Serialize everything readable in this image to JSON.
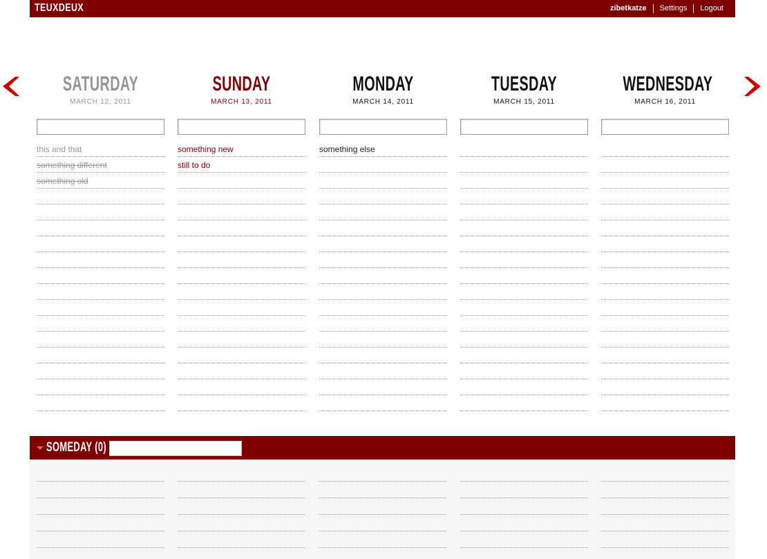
{
  "app": {
    "logo": "TEUXDEUX",
    "username": "zibetkatze",
    "settings_label": "Settings",
    "logout_label": "Logout",
    "brand_color": "#7f0000"
  },
  "nav": {
    "prev_icon": "chevron-left-icon",
    "next_icon": "chevron-right-icon",
    "arrow_color": "#cc0000"
  },
  "days": [
    {
      "name": "SATURDAY",
      "date": "MARCH 12, 2011",
      "state": "past",
      "input_value": "",
      "todos": [
        {
          "text": "this and that",
          "done": false
        },
        {
          "text": "something different",
          "done": true
        },
        {
          "text": "something old",
          "done": true
        }
      ]
    },
    {
      "name": "SUNDAY",
      "date": "MARCH 13, 2011",
      "state": "today",
      "input_value": "",
      "todos": [
        {
          "text": "something new",
          "done": false
        },
        {
          "text": "still to do",
          "done": false
        }
      ]
    },
    {
      "name": "MONDAY",
      "date": "MARCH 14, 2011",
      "state": "future",
      "input_value": "",
      "todos": [
        {
          "text": "something else",
          "done": false
        }
      ]
    },
    {
      "name": "TUESDAY",
      "date": "MARCH 15, 2011",
      "state": "future",
      "input_value": "",
      "todos": []
    },
    {
      "name": "WEDNESDAY",
      "date": "MARCH 16, 2011",
      "state": "future",
      "input_value": "",
      "todos": []
    }
  ],
  "someday": {
    "title": "SOMEDAY (0)",
    "toggle_icon": "triangle-down-icon",
    "input_value": ""
  }
}
